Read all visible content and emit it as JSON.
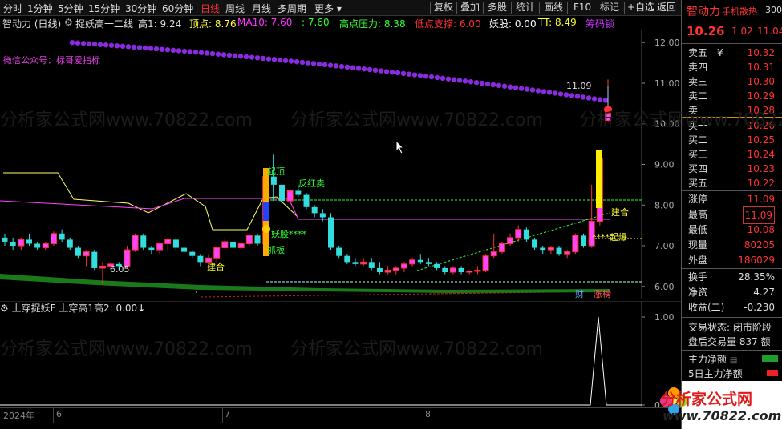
{
  "topbar": {
    "timeframes": [
      "分时",
      "1分钟",
      "5分钟",
      "15分钟",
      "30分钟",
      "60分钟",
      "日线",
      "周线",
      "月线",
      "多周期",
      "更多"
    ],
    "active": "日线",
    "buttons": [
      "复权",
      "叠加",
      "多股",
      "统计",
      "画线",
      "F10",
      "+自选",
      "返回"
    ]
  },
  "info": {
    "stock": "智动力 (日线)",
    "indicator": "捉妖高一二线",
    "items": [
      {
        "text": "高1: 9.24",
        "color": "#dddddd"
      },
      {
        "text": "顶点: 8.76",
        "color": "#ffff33"
      },
      {
        "text": "MA10: 7.60",
        "color": "#ff33ff"
      },
      {
        "text": ": 7.60",
        "color": "#33ff33"
      },
      {
        "text": "高点压力: 8.38",
        "color": "#33ff33"
      },
      {
        "text": "低点支撑: 6.00",
        "color": "#ff3333"
      },
      {
        "text": "妖股: 0.00",
        "color": "#ffffff"
      },
      {
        "text": "TT: 8.49",
        "color": "#ffff33"
      },
      {
        "text": "筹码锁",
        "color": "#cc33ff"
      }
    ],
    "wechat": "微信公众号：标哥爱指标"
  },
  "watermark": "分析家公式网www.70822.com",
  "main_axis": [
    "12.00",
    "11.00",
    "10.00",
    "9.00",
    "8.00",
    "7.00",
    "6.00"
  ],
  "annotations": {
    "high_price": "11.09",
    "low_price": "6.05",
    "jian_he_1": "建合",
    "jian_he_2": "建合",
    "qi_ding": "起顶",
    "fan_hong": "反红卖",
    "yao_gu": "妖股****",
    "zhua_ban": "抓板",
    "qi_bao": "****起爆",
    "cai": "财",
    "zhang_bang": "涨榜"
  },
  "sub": {
    "title": "上穿捉妖F",
    "value": "上穿高1高2: 0.00",
    "axis": [
      "1.00",
      "0.00"
    ]
  },
  "xaxis": {
    "labels": [
      "2024年",
      "6",
      "7",
      "8"
    ]
  },
  "rpanel": {
    "name": "智动力",
    "tag": "手机散热",
    "code": "300",
    "price": "10.26",
    "change": "1.02",
    "pct": "11.04",
    "asks": [
      {
        "label": "卖五",
        "price": "10.32",
        "vol": "¥"
      },
      {
        "label": "卖四",
        "price": "10.31",
        "vol": ""
      },
      {
        "label": "卖三",
        "price": "10.30",
        "vol": ""
      },
      {
        "label": "卖二",
        "price": "10.29",
        "vol": ""
      },
      {
        "label": "卖一",
        "price": "10.28",
        "vol": ""
      }
    ],
    "bids": [
      {
        "label": "买一",
        "price": "10.26"
      },
      {
        "label": "买二",
        "price": "10.25"
      },
      {
        "label": "买三",
        "price": "10.24"
      },
      {
        "label": "买四",
        "price": "10.23"
      },
      {
        "label": "买五",
        "price": "10.22"
      }
    ],
    "stats": [
      {
        "label": "涨停",
        "value": "11.09",
        "color": "#ff3333"
      },
      {
        "label": "最高",
        "value": "11.09",
        "color": "#ff3333"
      },
      {
        "label": "最低",
        "value": "10.08",
        "color": "#ff3333"
      },
      {
        "label": "现量",
        "value": "80205",
        "color": "#ff3333"
      },
      {
        "label": "外盘",
        "value": "186029",
        "color": "#ff3333"
      },
      {
        "label": "换手",
        "value": "28.35%",
        "color": "#dddddd"
      },
      {
        "label": "净资",
        "value": "4.27",
        "color": "#dddddd"
      },
      {
        "label": "收益(二)",
        "value": "-0.230",
        "color": "#dddddd"
      }
    ],
    "trade_status": "交易状态: 闭市阶段",
    "after_hours": "盘后交易量 837 额",
    "net_main": "主力净额",
    "net_main_5d": "5日主力净额",
    "logo_text": "分析家公式网",
    "logo_url": "www.70822.com"
  },
  "chart_data": {
    "type": "candlestick",
    "y_range": [
      5.7,
      12.3
    ],
    "candles_note": "approximate daily OHLC read from chart",
    "candles": [
      [
        7.2,
        7.3,
        7.0,
        7.1
      ],
      [
        7.1,
        7.2,
        6.9,
        7.0
      ],
      [
        7.0,
        7.2,
        6.9,
        7.15
      ],
      [
        7.15,
        7.3,
        7.0,
        7.05
      ],
      [
        7.05,
        7.1,
        6.9,
        6.95
      ],
      [
        6.95,
        7.1,
        6.9,
        7.05
      ],
      [
        7.05,
        7.35,
        7.0,
        7.3
      ],
      [
        7.3,
        7.4,
        7.1,
        7.15
      ],
      [
        7.15,
        7.2,
        6.9,
        6.95
      ],
      [
        6.95,
        7.0,
        6.7,
        6.75
      ],
      [
        6.75,
        6.9,
        6.5,
        6.85
      ],
      [
        6.85,
        6.9,
        6.4,
        6.45
      ],
      [
        6.45,
        6.6,
        6.05,
        6.5
      ],
      [
        6.5,
        6.6,
        6.4,
        6.55
      ],
      [
        6.55,
        6.6,
        6.4,
        6.5
      ],
      [
        6.5,
        7.0,
        6.45,
        6.9
      ],
      [
        6.9,
        7.3,
        6.85,
        7.25
      ],
      [
        7.25,
        7.3,
        6.9,
        6.95
      ],
      [
        6.95,
        7.0,
        6.8,
        6.9
      ],
      [
        6.9,
        7.1,
        6.8,
        7.05
      ],
      [
        7.05,
        7.2,
        6.9,
        7.15
      ],
      [
        7.15,
        7.2,
        6.9,
        6.95
      ],
      [
        6.95,
        7.0,
        6.8,
        6.85
      ],
      [
        6.85,
        6.9,
        6.7,
        6.75
      ],
      [
        6.75,
        6.8,
        6.5,
        6.6
      ],
      [
        6.6,
        6.8,
        6.5,
        6.7
      ],
      [
        6.7,
        7.0,
        6.6,
        6.95
      ],
      [
        6.95,
        7.2,
        6.9,
        7.1
      ],
      [
        7.1,
        7.2,
        6.9,
        6.95
      ],
      [
        6.95,
        7.1,
        6.9,
        7.05
      ],
      [
        7.05,
        7.3,
        7.0,
        7.25
      ],
      [
        7.25,
        7.3,
        7.0,
        7.05
      ],
      [
        7.05,
        8.8,
        7.0,
        8.7
      ],
      [
        8.7,
        9.24,
        8.1,
        8.5
      ],
      [
        8.5,
        8.6,
        8.0,
        8.1
      ],
      [
        8.1,
        8.4,
        8.0,
        8.35
      ],
      [
        8.35,
        8.5,
        8.2,
        8.25
      ],
      [
        8.25,
        8.3,
        7.9,
        7.95
      ],
      [
        7.95,
        8.0,
        7.7,
        7.8
      ],
      [
        7.8,
        7.9,
        7.6,
        7.7
      ],
      [
        7.7,
        7.8,
        6.9,
        6.95
      ],
      [
        6.95,
        7.0,
        6.7,
        6.75
      ],
      [
        6.75,
        6.8,
        6.55,
        6.6
      ],
      [
        6.6,
        6.7,
        6.5,
        6.55
      ],
      [
        6.55,
        6.7,
        6.5,
        6.6
      ],
      [
        6.6,
        6.7,
        6.4,
        6.45
      ],
      [
        6.45,
        6.6,
        6.3,
        6.35
      ],
      [
        6.35,
        6.5,
        6.3,
        6.4
      ],
      [
        6.4,
        6.5,
        6.3,
        6.45
      ],
      [
        6.45,
        6.6,
        6.35,
        6.55
      ],
      [
        6.55,
        6.7,
        6.5,
        6.65
      ],
      [
        6.65,
        6.8,
        6.55,
        6.6
      ],
      [
        6.6,
        6.7,
        6.5,
        6.55
      ],
      [
        6.55,
        6.6,
        6.4,
        6.45
      ],
      [
        6.45,
        6.5,
        6.3,
        6.35
      ],
      [
        6.35,
        6.5,
        6.3,
        6.45
      ],
      [
        6.45,
        6.5,
        6.3,
        6.35
      ],
      [
        6.35,
        6.4,
        6.3,
        6.38
      ],
      [
        6.38,
        6.5,
        6.3,
        6.4
      ],
      [
        6.4,
        6.8,
        6.35,
        6.75
      ],
      [
        6.75,
        7.3,
        6.7,
        6.85
      ],
      [
        6.85,
        7.1,
        6.8,
        7.05
      ],
      [
        7.05,
        7.3,
        7.0,
        7.2
      ],
      [
        7.2,
        7.5,
        7.1,
        7.4
      ],
      [
        7.4,
        7.45,
        7.1,
        7.15
      ],
      [
        7.15,
        7.2,
        6.9,
        6.95
      ],
      [
        6.95,
        7.0,
        6.8,
        6.9
      ],
      [
        6.9,
        7.0,
        6.8,
        6.95
      ],
      [
        6.95,
        7.0,
        6.75,
        6.8
      ],
      [
        6.8,
        6.9,
        6.7,
        6.85
      ],
      [
        6.85,
        7.3,
        6.8,
        7.25
      ],
      [
        7.25,
        7.3,
        6.95,
        7.0
      ],
      [
        7.0,
        8.5,
        6.95,
        7.6
      ],
      [
        7.6,
        9.2,
        7.5,
        9.15
      ],
      [
        10.08,
        11.09,
        10.08,
        10.26
      ]
    ],
    "ma_purple_dots": [
      12.0,
      10.5
    ],
    "upper_line": [
      8.45,
      8.45
    ],
    "support_line": [
      6.0,
      6.0
    ]
  }
}
